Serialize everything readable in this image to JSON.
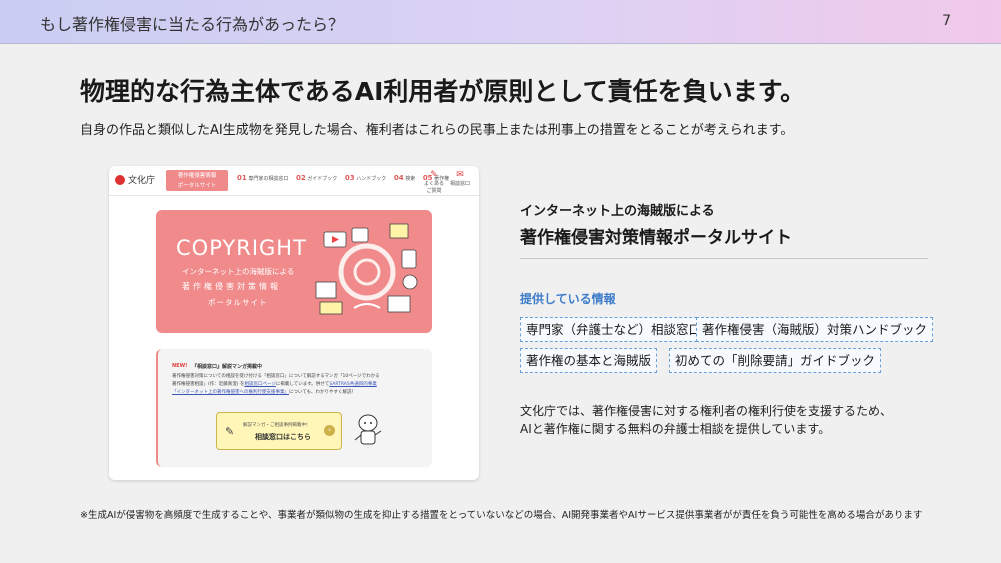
{
  "header": {
    "title": "もし著作権侵害に当たる行為があったら？",
    "page_number": "7"
  },
  "main_title": "物理的な行為主体であるAI利用者が原則として責任を負います。",
  "subtitle": "自身の作品と類似したAI生成物を発見した場合、権利者はこれらの民事上または刑事上の措置をとることが考えられます。",
  "screenshot": {
    "logo": "文化庁",
    "badge_line1": "著作権侵害情報",
    "badge_line2": "ポータルサイト",
    "nav": [
      {
        "num": "01",
        "label": "専門家の相談窓口"
      },
      {
        "num": "02",
        "label": "ガイドブック"
      },
      {
        "num": "03",
        "label": "ハンドブック"
      },
      {
        "num": "04",
        "label": "検索"
      },
      {
        "num": "05",
        "label": "著作権"
      }
    ],
    "nav_icon_faq": "よくあるご質問",
    "nav_icon_contact": "相談窓口",
    "hero": {
      "title": "COPYRIGHT",
      "line1": "インターネット上の海賊版による",
      "line2": "著作権侵害対策情報",
      "line3": "ポータルサイト"
    },
    "news": {
      "tag": "NEW!",
      "headline": "『相談窓口』解説マンガ掲載中",
      "body1": "著作権侵害対策についての相談を受け付ける「相談窓口」について解説するマンガ「10ページでわかる",
      "body2": "著作権侵害相談」(作：近藤真澄) を",
      "body_link1": "相談窓口ページ",
      "body3": "に掲載しています。併せて",
      "body_link2": "SARTRAS共通目的事業",
      "body4": "「インターネット上の著作権侵害への権利行使支援事業」",
      "body5": "についても、わかりやすく解説！",
      "button_small": "解説マンガ・ご相談事例掲載中!",
      "button_main": "相談窓口はこちら",
      "button_arrow": "›"
    }
  },
  "right_panel": {
    "kicker": "インターネット上の海賊版による",
    "title": "著作権侵害対策情報ポータルサイト",
    "section_label": "提供している情報",
    "tags": [
      "専門家（弁護士など）相談窓口",
      "著作権侵害（海賊版）対策ハンドブック",
      "著作権の基本と海賊版",
      "初めての「削除要請」ガイドブック"
    ],
    "description": "文化庁では、著作権侵害に対する権利者の権利行使を支援するため、AIと著作権に関する無料の弁護士相談を提供しています。"
  },
  "footnote": "※生成AIが侵害物を高頻度で生成することや、事業者が類似物の生成を抑止する措置をとっていないなどの場合、AI開発事業者やAIサービス提供事業者がが責任を負う可能性を高める場合があります",
  "colors": {
    "accent_blue": "#3d7cc9",
    "hero_pink": "#f18b8b",
    "tag_border": "#6aa0d8"
  }
}
